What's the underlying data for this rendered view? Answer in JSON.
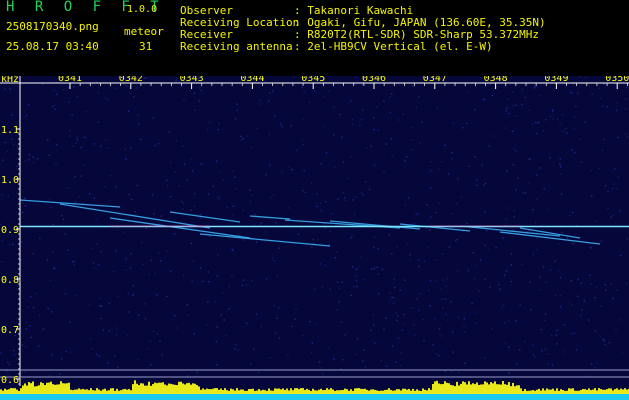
{
  "app": {
    "brand": "H R O F F T",
    "version": "1.0.0",
    "filename": "2508170340.png",
    "timestamp": "25.08.17 03:40",
    "meteor_label": "meteor",
    "meteor_count": "31"
  },
  "info": {
    "labels": [
      "Observer",
      "Receiving Location",
      "Receiver",
      "Receiving antenna"
    ],
    "values": [
      ": Takanori Kawachi",
      ": Ogaki, Gifu, JAPAN (136.60E, 35.35N)",
      ": R820T2(RTL-SDR) SDR-Sharp 53.372MHz",
      ": 2el-HB9CV Vertical (el. E-W)"
    ]
  },
  "chart_data": {
    "type": "heatmap",
    "ylabel": "kHz",
    "x_ticks": [
      "0341",
      "0342",
      "0343",
      "0344",
      "0345",
      "0346",
      "0347",
      "0348",
      "0349",
      "0350"
    ],
    "y_ticks": [
      "1.1",
      "1.0",
      "0.9",
      "0.8",
      "0.7",
      "0.6"
    ],
    "ylim": [
      0.6,
      1.15
    ],
    "carrier_khz": 0.905,
    "colors": {
      "background": "#05063a",
      "axis": "#ffffff",
      "tick_label": "#ffff00",
      "carrier": "#7fe8ff",
      "meteor": "#3fb8ff",
      "power_bar": "#e8e81a",
      "power_base": "#19c9f2"
    }
  }
}
